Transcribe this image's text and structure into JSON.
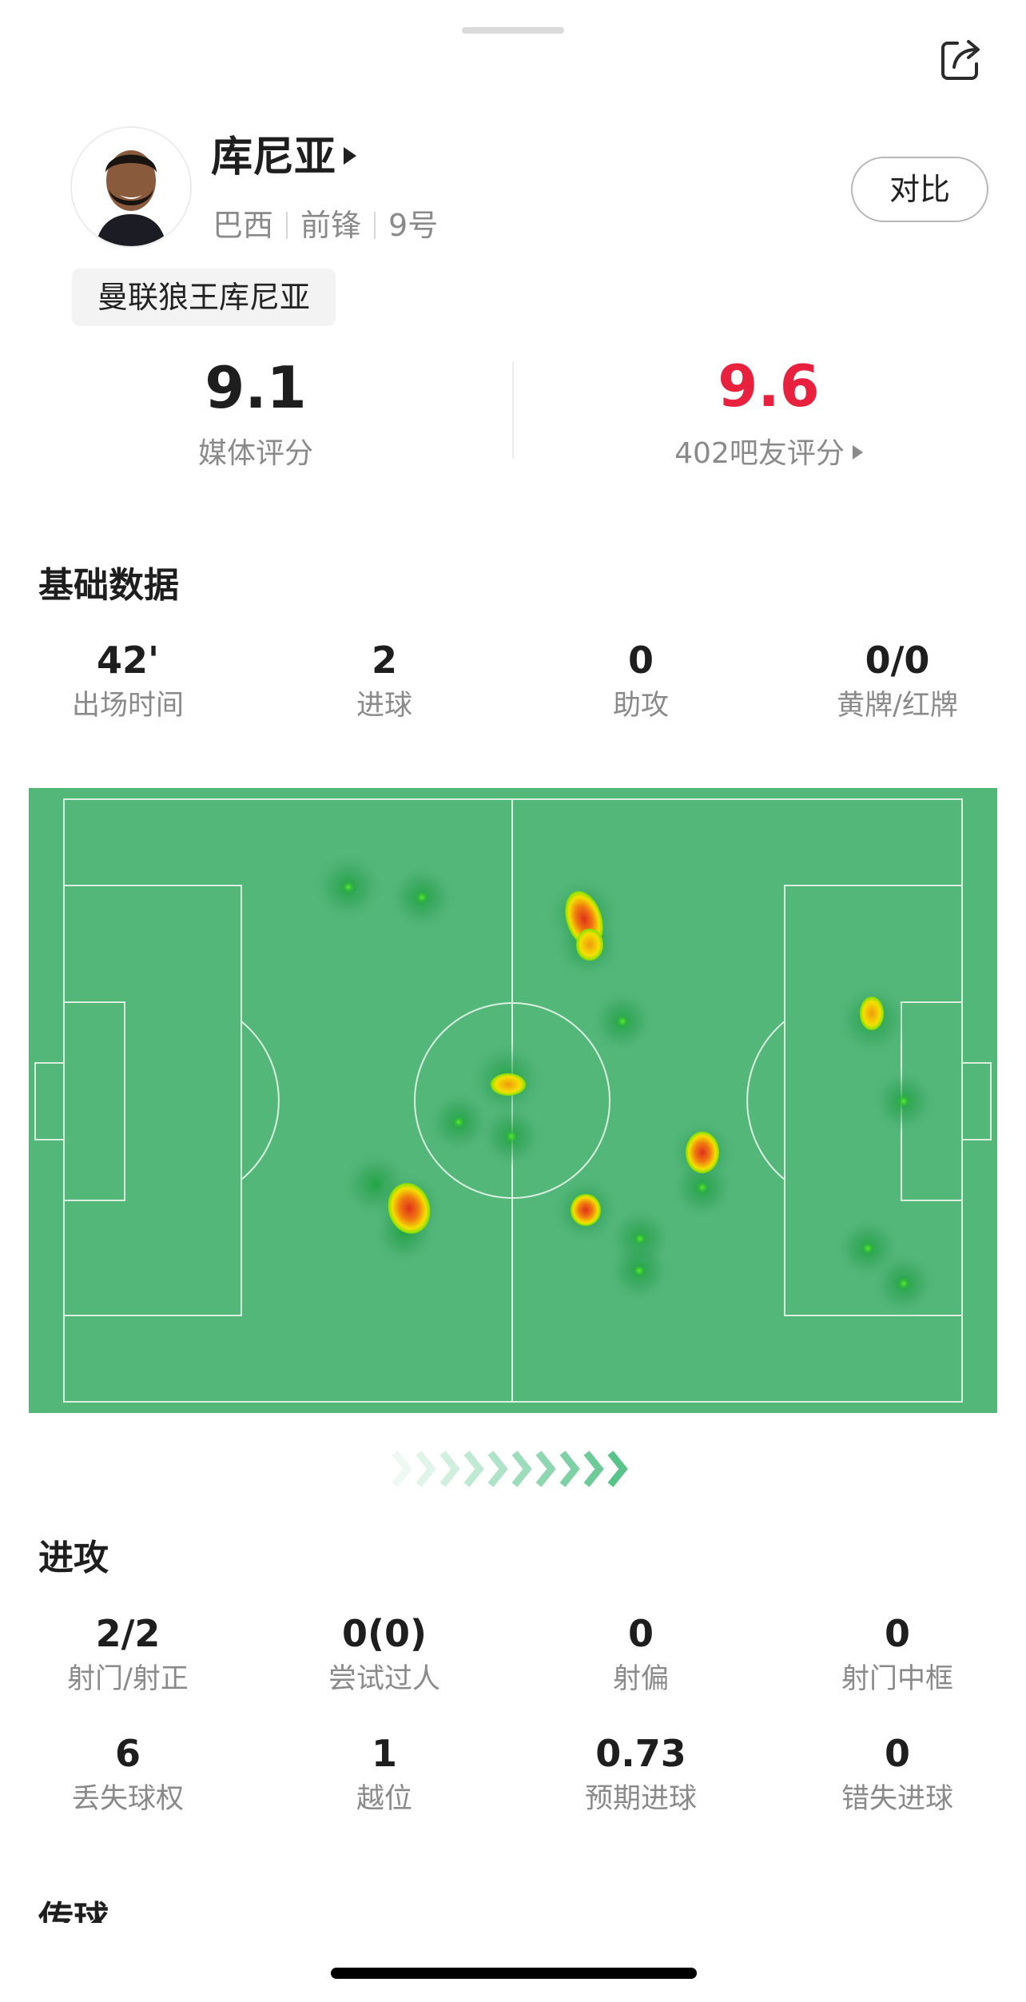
{
  "player": {
    "name": "库尼亚",
    "nationality": "巴西",
    "position": "前锋",
    "number": "9号",
    "nickname": "曼联狼王库尼亚",
    "compare_label": "对比"
  },
  "ratings": {
    "media_value": "9.1",
    "media_label": "媒体评分",
    "fan_value": "9.6",
    "fan_label": "402吧友评分",
    "fan_value_color": "#e8213e"
  },
  "basic": {
    "title": "基础数据",
    "stats": [
      {
        "value": "42'",
        "label": "出场时间"
      },
      {
        "value": "2",
        "label": "进球"
      },
      {
        "value": "0",
        "label": "助攻"
      },
      {
        "value": "0/0",
        "label": "黄牌/红牌"
      }
    ]
  },
  "heatmap": {
    "pitch_color": "#53b77a",
    "attack_direction": "right"
  },
  "attack": {
    "title": "进攻",
    "stats": [
      {
        "value": "2/2",
        "label": "射门/射正"
      },
      {
        "value": "0(0)",
        "label": "尝试过人"
      },
      {
        "value": "0",
        "label": "射偏"
      },
      {
        "value": "0",
        "label": "射门中框"
      },
      {
        "value": "6",
        "label": "丢失球权"
      },
      {
        "value": "1",
        "label": "越位"
      },
      {
        "value": "0.73",
        "label": "预期进球"
      },
      {
        "value": "0",
        "label": "错失进球"
      }
    ]
  },
  "next_section": {
    "title": "传球"
  },
  "icons": {
    "share": "share-icon",
    "avatar": "player-avatar",
    "direction": "attack-direction-chevrons-icon"
  }
}
